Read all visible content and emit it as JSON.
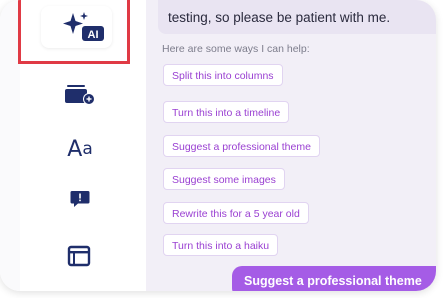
{
  "sidebar": {
    "ai_tool": {
      "icon": "sparkle-ai-icon",
      "badge": "AI"
    },
    "tools": [
      {
        "name": "add-slide-icon"
      },
      {
        "name": "text-style-icon",
        "glyph_large": "A",
        "glyph_small": "a"
      },
      {
        "name": "comment-icon"
      },
      {
        "name": "layout-icon"
      }
    ],
    "highlight_color": "#e03a45",
    "icon_color": "#1f2e6b"
  },
  "chat": {
    "assistant_message": "testing, so please be patient with me.",
    "intro": "Here are some ways I can help:",
    "suggestions": [
      "Split this into columns",
      "Turn this into a timeline",
      "Suggest a professional theme",
      "Suggest some images",
      "Rewrite this for a 5 year old",
      "Turn this into a haiku"
    ],
    "user_message": "Suggest a professional theme",
    "accent_color": "#9a40d2",
    "user_bubble_color": "#a55ce6"
  }
}
